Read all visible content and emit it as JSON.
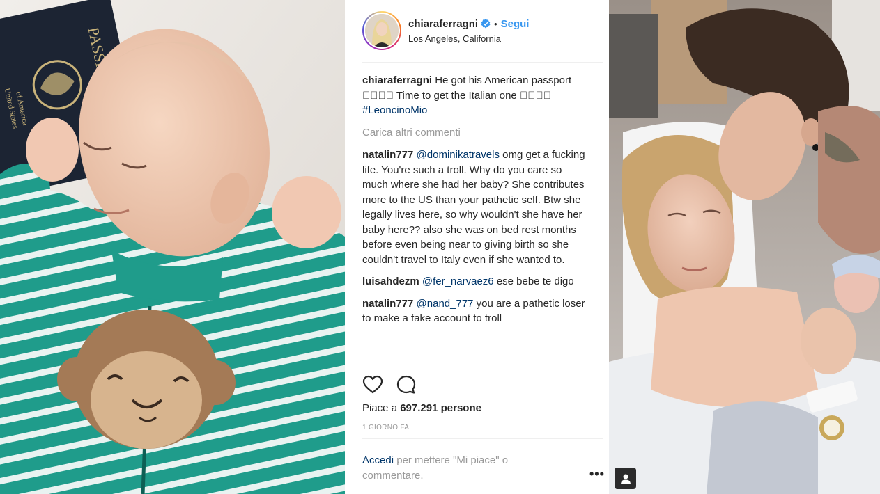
{
  "post": {
    "username": "chiaraferragni",
    "verified": true,
    "follow_label": "Segui",
    "dot": "•",
    "location": "Los Angeles, California",
    "caption": {
      "user": "chiaraferragni",
      "text_before": " He got his American passport \u0000\u0000\u0000\u0000 Time to get the Italian one \u0000\u0000\u0000\u0000 ",
      "hashtag": "#LeoncinoMio"
    },
    "load_more_label": "Carica altri commenti",
    "comments": [
      {
        "user": "natalin777",
        "mention": "@dominikatravels",
        "text": " omg get a fucking life. You're such a troll. Why do you care so much where she had her baby? She contributes more to the US than your pathetic self. Btw she legally lives here, so why wouldn't she have her baby here?? also she was on bed rest months before even being near to giving birth so she couldn't travel to Italy even if she wanted to."
      },
      {
        "user": "luisahdezm",
        "mention": "@fer_narvaez6",
        "text": " ese bebe te digo"
      },
      {
        "user": "natalin777",
        "mention": "@nand_777",
        "text": " you are a pathetic loser to make a fake account to troll"
      }
    ],
    "likes_prefix": "Piace a ",
    "likes_count": "697.291",
    "likes_suffix": " persone",
    "timestamp": "1 GIORNO FA",
    "login_link": "Accedi",
    "login_text": " per mettere \"Mi piace\" o commentare.",
    "more_options": "•••"
  },
  "icons": {
    "like": "heart-icon",
    "comment": "comment-icon",
    "verified": "verified-badge-icon",
    "tag": "user-tag-icon",
    "more": "more-options-icon"
  },
  "colors": {
    "link": "#3897f0",
    "mention": "#003569",
    "muted": "#999999",
    "text": "#262626"
  },
  "photos": {
    "passport_text_1": "PASSPORT",
    "passport_text_2": "United States",
    "passport_text_3": "of America"
  }
}
